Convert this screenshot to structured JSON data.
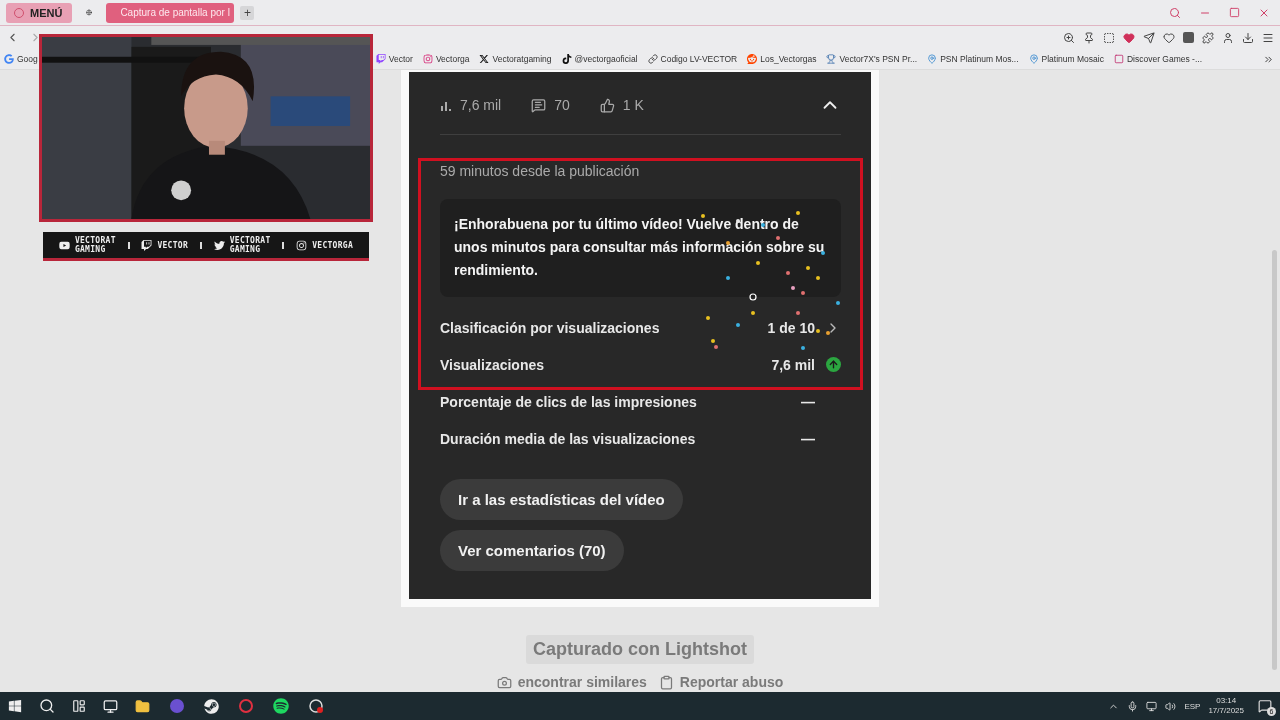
{
  "browser": {
    "menu_button": "MENÚ",
    "new_tab": "+",
    "tabs": [
      {
        "kind": "pinned",
        "selected": false
      },
      {
        "kind": "page",
        "label": "Captura de pantalla por l",
        "selected": true
      }
    ],
    "bookmarks": [
      {
        "kind": "google",
        "label": "Goog"
      },
      {
        "kind": "twitch",
        "label": "Vector"
      },
      {
        "kind": "instagram",
        "label": "Vectorga"
      },
      {
        "kind": "x",
        "label": "Vectoratgaming"
      },
      {
        "kind": "tiktok",
        "label": "@vectorgaoficial"
      },
      {
        "kind": "link",
        "label": "Codigo LV-VECTOR"
      },
      {
        "kind": "reddit",
        "label": "Los_Vectorgas"
      },
      {
        "kind": "trophy",
        "label": "Vector7X's PSN Pr..."
      },
      {
        "kind": "pin",
        "label": "PSN Platinum Mos..."
      },
      {
        "kind": "pin",
        "label": "Platinum Mosaic"
      },
      {
        "kind": "kn",
        "label": "Discover Games -..."
      }
    ]
  },
  "stream_overlay": {
    "socials": [
      {
        "kind": "youtube",
        "lines": [
          "VECTORAT",
          "GAMING"
        ]
      },
      {
        "kind": "twitch",
        "lines": [
          "VECTOR"
        ]
      },
      {
        "kind": "twitter",
        "lines": [
          "VECTORAT",
          "GAMING"
        ]
      },
      {
        "kind": "instagram",
        "lines": [
          "VECTORGA"
        ]
      }
    ]
  },
  "video_stats": {
    "views": "7,6 mil",
    "comments": "70",
    "likes": "1 K",
    "expanded": true,
    "published": "59 minutos desde la publicación",
    "message": "¡Enhorabuena por tu último vídeo! Vuelve dentro de unos minutos para consultar más información sobre su rendimiento.",
    "metrics": [
      {
        "kind": "link",
        "label": "Clasificación por visualizaciones",
        "value": "1 de 10"
      },
      {
        "kind": "trend_up",
        "label": "Visualizaciones",
        "value": "7,6 mil"
      },
      {
        "kind": "plain",
        "label": "Porcentaje de clics de las impresiones",
        "value": "—"
      },
      {
        "kind": "plain",
        "label": "Duración media de las visualizaciones",
        "value": "—"
      }
    ],
    "buttons": [
      "Ir a las estadísticas del vídeo",
      "Ver comentarios (70)"
    ]
  },
  "lightshot": {
    "caption": "Capturado con Lightshot",
    "links": [
      {
        "kind": "similar",
        "label": "encontrar similares"
      },
      {
        "kind": "report",
        "label": "Reportar abuso"
      }
    ]
  },
  "taskbar": {
    "language": "ESP",
    "time": "03:14",
    "date": "17/7/2025",
    "notifications": "6"
  }
}
